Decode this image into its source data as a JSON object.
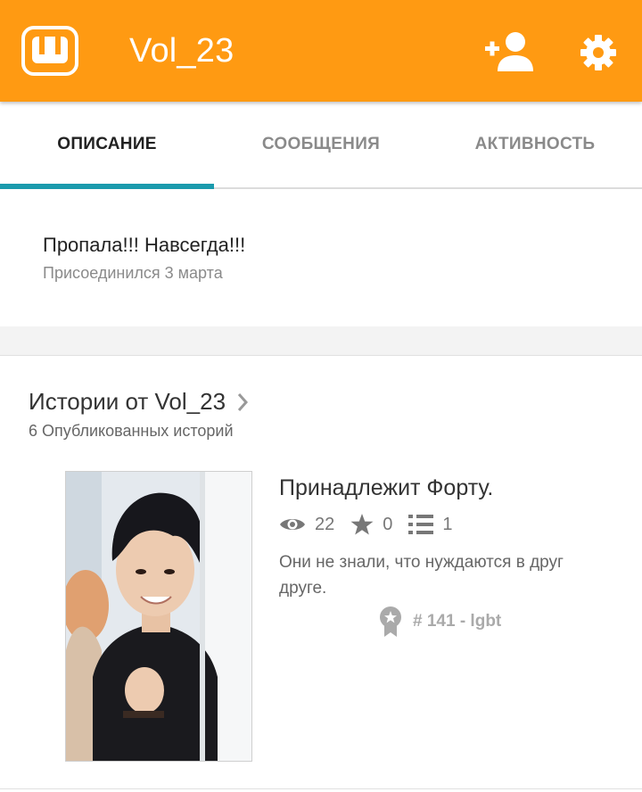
{
  "appbar": {
    "title": "Vol_23",
    "logo_icon": "wattpad-logo-icon",
    "actions": [
      {
        "name": "add-user",
        "icon": "add-user-icon"
      },
      {
        "name": "settings",
        "icon": "gear-icon"
      }
    ],
    "color": "#ff9a12"
  },
  "tabs": [
    {
      "label": "ОПИСАНИЕ",
      "active": true
    },
    {
      "label": "СООБЩЕНИЯ",
      "active": false
    },
    {
      "label": "АКТИВНОСТЬ",
      "active": false
    }
  ],
  "accent_color": "#1a9aad",
  "about": {
    "tagline": "Пропала!!! Навсегда!!!",
    "joined": "Присоединился 3 марта"
  },
  "stories": {
    "title": "Истории от Vol_23",
    "count_text": "6 Опубликованных историй",
    "items": [
      {
        "title": "Принадлежит Форту.",
        "reads": "22",
        "votes": "0",
        "parts": "1",
        "description": "Они не знали, что нуждаются в друг друге.",
        "rank": "# 141 - lgbt"
      }
    ]
  }
}
